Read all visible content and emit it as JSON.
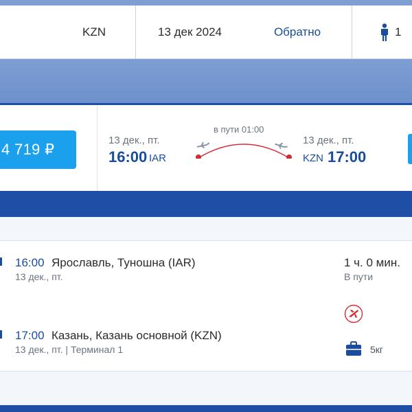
{
  "search": {
    "to_code": "KZN",
    "date": "13 дек 2024",
    "return_label": "Обратно",
    "passengers": "1"
  },
  "flight": {
    "price": "4 719 ₽",
    "departure": {
      "date": "13 дек., пт.",
      "time": "16:00",
      "code": "IAR"
    },
    "duration": "в пути 01:00",
    "arrival": {
      "date": "13 дек., пт.",
      "time": "17:00",
      "code": "KZN"
    }
  },
  "details": {
    "departure": {
      "time": "16:00",
      "place": "Ярославль, Туношна (IAR)",
      "sub": "13 дек., пт."
    },
    "arrival": {
      "time": "17:00",
      "place": "Казань, Казань основной (KZN)",
      "sub": "13 дек., пт. | Терминал 1"
    },
    "duration_value": "1 ч. 0 мин.",
    "duration_label": "В пути",
    "baggage": "5кг"
  },
  "colors": {
    "accent": "#1aa0ec",
    "brand_dark": "#1f4ea6",
    "route_red": "#d62b35"
  },
  "icons": [
    "person-icon",
    "plane-takeoff-icon",
    "plane-landing-icon",
    "airline-logo-icon",
    "baggage-icon"
  ]
}
